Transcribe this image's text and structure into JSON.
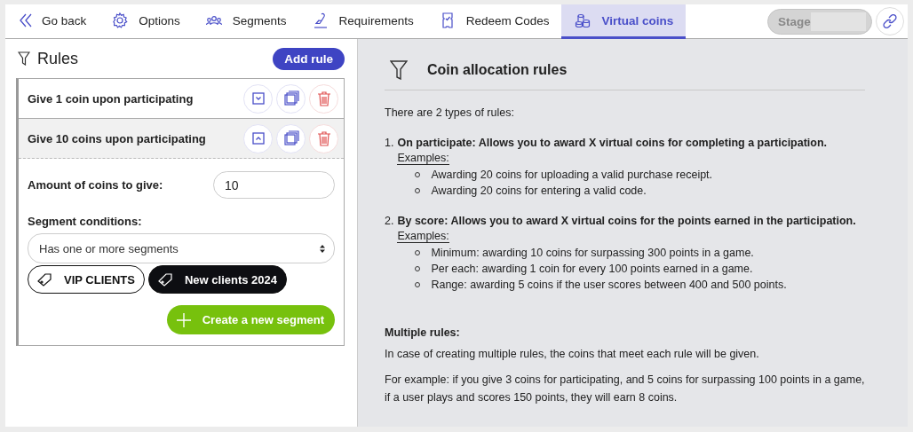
{
  "nav": {
    "back": "Go back",
    "tabs": [
      {
        "label": "Options",
        "selected": false
      },
      {
        "label": "Segments",
        "selected": false
      },
      {
        "label": "Requirements",
        "selected": false
      },
      {
        "label": "Redeem Codes",
        "selected": false
      },
      {
        "label": "Virtual coins",
        "selected": true
      }
    ],
    "environment": "Stage"
  },
  "rules_panel": {
    "title": "Rules",
    "add_button": "Add rule",
    "rules": [
      {
        "title": "Give 1 coin upon participating",
        "expanded": false
      },
      {
        "title": "Give 10 coins upon participating",
        "expanded": true,
        "amount_label": "Amount of coins to give:",
        "amount": "10",
        "segment_label": "Segment conditions:",
        "segment_condition": "Has one or more segments",
        "segments": [
          {
            "label": "VIP CLIENTS",
            "selected": false
          },
          {
            "label": "New clients 2024",
            "selected": true
          }
        ],
        "create_button": "Create a new segment"
      }
    ]
  },
  "help": {
    "title": "Coin allocation rules",
    "intro": "There are 2 types of rules:",
    "items": [
      {
        "number": "1.",
        "title": "On participate: Allows you to award X virtual coins for completing a participation.",
        "examples_label": "Examples:",
        "examples": [
          "Awarding 20 coins for uploading a valid purchase receipt.",
          "Awarding 20 coins for entering a valid code."
        ]
      },
      {
        "number": "2.",
        "title": "By score: Allows you to award X virtual coins for the points earned in the participation.",
        "examples_label": "Examples:",
        "examples": [
          "Minimum: awarding 10 coins for surpassing 300 points in a game.",
          "Per each: awarding 1 coin for every 100 points earned in a game.",
          "Range: awarding 5 coins if the user scores between 400 and 500 points."
        ]
      }
    ],
    "multiple_title": "Multiple rules:",
    "paragraphs": [
      "In case of creating multiple rules, the coins that meet each rule will be given.",
      "For example: if you give 3 coins for participating, and 5 coins for surpassing 100 points in a game, if a user plays and scores 150 points, they will earn 8 coins."
    ]
  }
}
